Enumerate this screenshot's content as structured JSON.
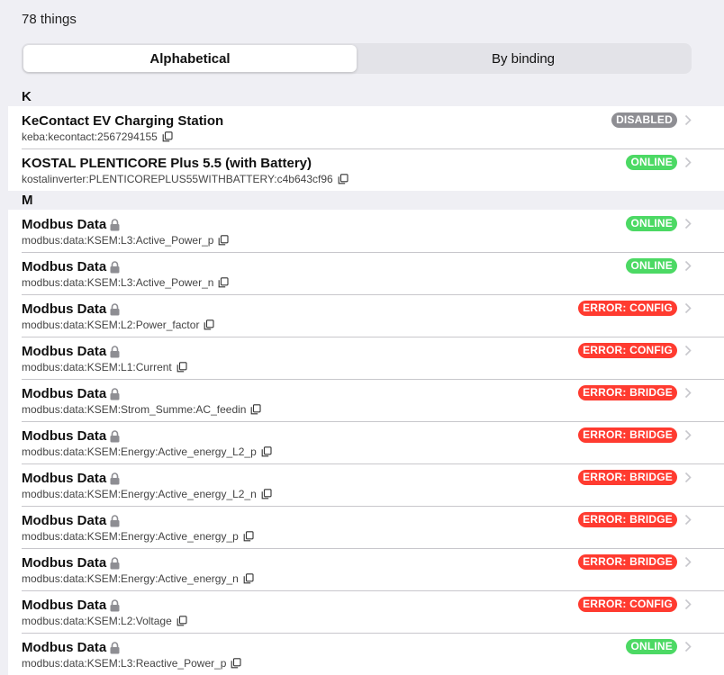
{
  "header": {
    "count_label": "78 things"
  },
  "tabs": [
    {
      "label": "Alphabetical",
      "active": true
    },
    {
      "label": "By binding",
      "active": false
    }
  ],
  "status_colors": {
    "DISABLED": "#8e8e93",
    "ONLINE": "#4cd964",
    "ERROR: CONFIG": "#ff3b30",
    "ERROR: BRIDGE": "#ff3b30"
  },
  "groups": [
    {
      "letter": "K",
      "items": [
        {
          "title": "KeContact EV Charging Station",
          "uid": "keba:kecontact:2567294155",
          "status": "DISABLED",
          "locked": false
        },
        {
          "title": "KOSTAL PLENTICORE Plus 5.5 (with Battery)",
          "uid": "kostalinverter:PLENTICOREPLUS55WITHBATTERY:c4b643cf96",
          "status": "ONLINE",
          "locked": false
        }
      ]
    },
    {
      "letter": "M",
      "items": [
        {
          "title": "Modbus Data",
          "uid": "modbus:data:KSEM:L3:Active_Power_p",
          "status": "ONLINE",
          "locked": true
        },
        {
          "title": "Modbus Data",
          "uid": "modbus:data:KSEM:L3:Active_Power_n",
          "status": "ONLINE",
          "locked": true
        },
        {
          "title": "Modbus Data",
          "uid": "modbus:data:KSEM:L2:Power_factor",
          "status": "ERROR: CONFIG",
          "locked": true
        },
        {
          "title": "Modbus Data",
          "uid": "modbus:data:KSEM:L1:Current",
          "status": "ERROR: CONFIG",
          "locked": true
        },
        {
          "title": "Modbus Data",
          "uid": "modbus:data:KSEM:Strom_Summe:AC_feedin",
          "status": "ERROR: BRIDGE",
          "locked": true
        },
        {
          "title": "Modbus Data",
          "uid": "modbus:data:KSEM:Energy:Active_energy_L2_p",
          "status": "ERROR: BRIDGE",
          "locked": true
        },
        {
          "title": "Modbus Data",
          "uid": "modbus:data:KSEM:Energy:Active_energy_L2_n",
          "status": "ERROR: BRIDGE",
          "locked": true
        },
        {
          "title": "Modbus Data",
          "uid": "modbus:data:KSEM:Energy:Active_energy_p",
          "status": "ERROR: BRIDGE",
          "locked": true
        },
        {
          "title": "Modbus Data",
          "uid": "modbus:data:KSEM:Energy:Active_energy_n",
          "status": "ERROR: BRIDGE",
          "locked": true
        },
        {
          "title": "Modbus Data",
          "uid": "modbus:data:KSEM:L2:Voltage",
          "status": "ERROR: CONFIG",
          "locked": true
        },
        {
          "title": "Modbus Data",
          "uid": "modbus:data:KSEM:L3:Reactive_Power_p",
          "status": "ONLINE",
          "locked": true
        }
      ]
    }
  ]
}
